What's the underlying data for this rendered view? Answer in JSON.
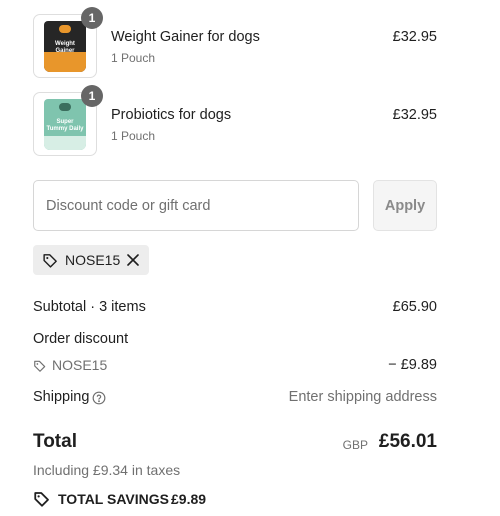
{
  "line_items": [
    {
      "quantity": "1",
      "name": "Weight Gainer for dogs",
      "variant": "1 Pouch",
      "price": "£32.95",
      "pack_text": "Weight Gainer",
      "pack_colors": {
        "pouch": "#262626",
        "band": "#e8962b"
      }
    },
    {
      "quantity": "1",
      "name": "Probiotics for dogs",
      "variant": "1 Pouch",
      "price": "£32.95",
      "pack_text": "Super Tummy Daily",
      "pack_colors": {
        "pouch": "#7fc4ae",
        "band": "#d7eee5"
      }
    }
  ],
  "discount": {
    "placeholder": "Discount code or gift card",
    "value": "",
    "apply_label": "Apply",
    "applied_code": "NOSE15",
    "tag_icon": "tag-icon",
    "remove_icon": "close-icon"
  },
  "summary": {
    "subtotal_label": "Subtotal · 3 items",
    "subtotal_value": "£65.90",
    "order_discount_label": "Order discount",
    "discount_code": "NOSE15",
    "discount_value": "− £9.89",
    "shipping_label": "Shipping",
    "shipping_help_icon": "help-circle-icon",
    "shipping_value": "Enter shipping address",
    "total_label": "Total",
    "currency": "GBP",
    "total_value": "£56.01",
    "taxes_note": "Including £9.34 in taxes",
    "savings_label": "TOTAL SAVINGS",
    "savings_value": "£9.89"
  },
  "colors": {
    "badge": "#666666",
    "chip_bg": "#ededed",
    "button_bg": "#f5f5f5",
    "muted_text": "#707070"
  }
}
